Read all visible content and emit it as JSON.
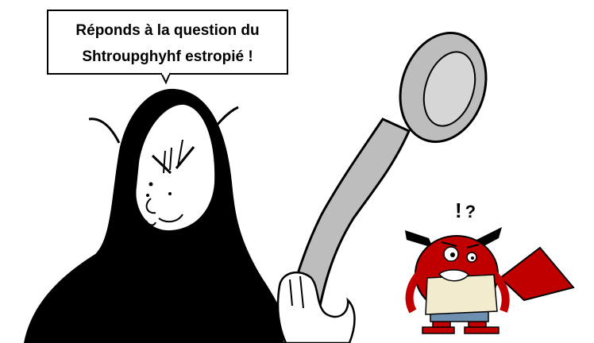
{
  "speech_bubble": {
    "line1": "Réponds à la question du",
    "line2": "Shtroupghyhf estropié !"
  },
  "reaction": {
    "exclaim": "!",
    "question": "?"
  },
  "colors": {
    "background": "#ffffff",
    "robe": "#000000",
    "spoon": "#bdbdbd",
    "creature": "#c00000",
    "apron": "#f2eccf",
    "shorts": "#6f8fb0"
  }
}
